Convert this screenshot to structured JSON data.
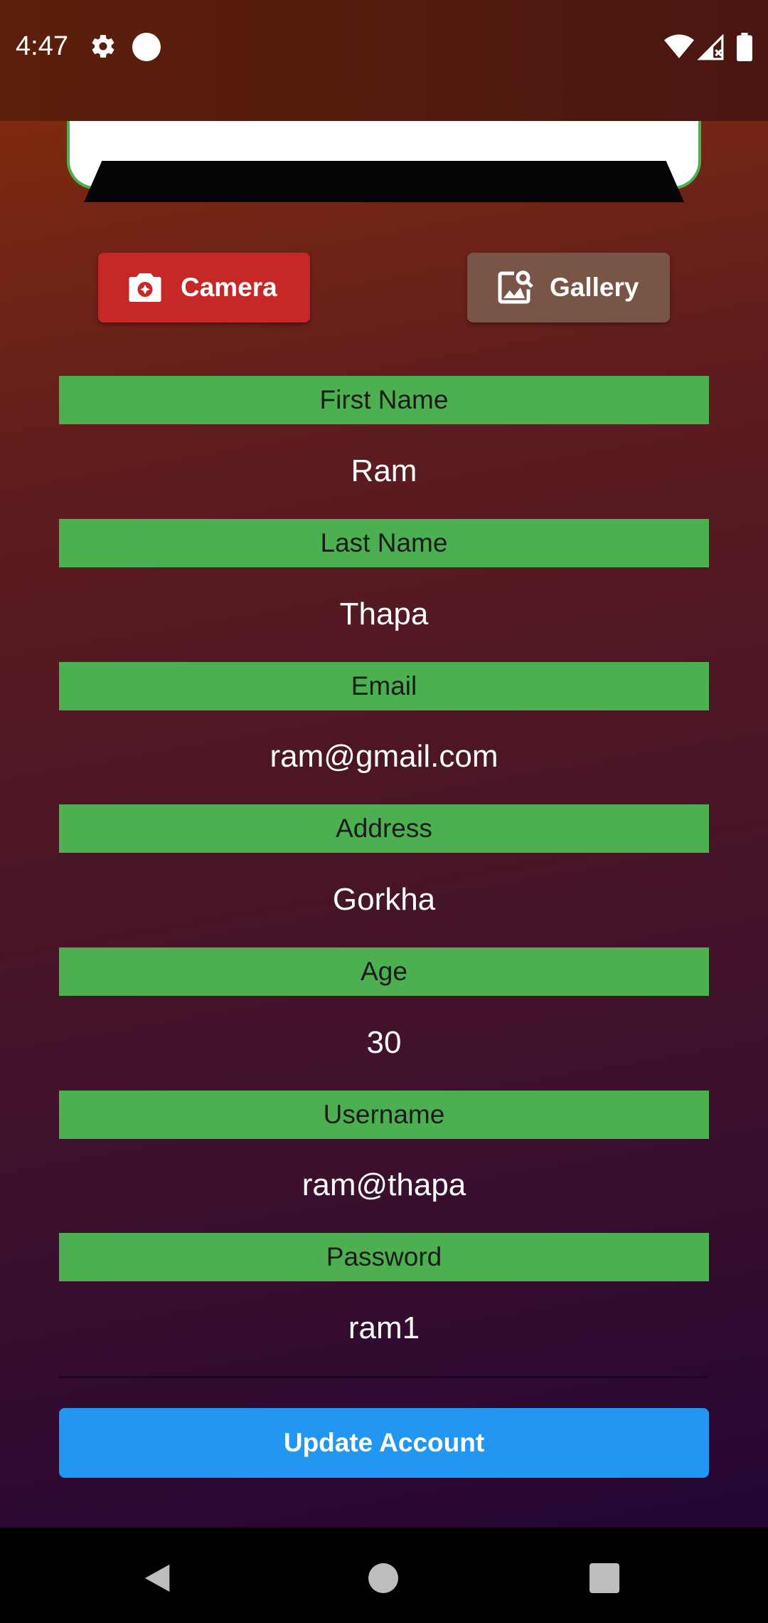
{
  "status_bar": {
    "time": "4:47",
    "icons": [
      "gear-icon",
      "circle-notification-icon",
      "wifi-icon",
      "signal-icon",
      "battery-icon"
    ]
  },
  "image_picker": {
    "camera_label": "Camera",
    "gallery_label": "Gallery",
    "camera_color": "#c62828",
    "gallery_color": "#795548"
  },
  "form": {
    "fields": [
      {
        "label": "First Name",
        "value": "Ram"
      },
      {
        "label": "Last Name",
        "value": "Thapa"
      },
      {
        "label": "Email",
        "value": "ram@gmail.com"
      },
      {
        "label": "Address",
        "value": "Gorkha"
      },
      {
        "label": "Age",
        "value": "30"
      },
      {
        "label": "Username",
        "value": "ram@thapa"
      },
      {
        "label": "Password",
        "value": "ram1"
      }
    ],
    "label_color": "#4caf50",
    "submit_label": "Update Account",
    "submit_color": "#2196f3"
  },
  "nav_bar": {
    "icons": [
      "back-icon",
      "home-icon",
      "recents-icon"
    ]
  }
}
